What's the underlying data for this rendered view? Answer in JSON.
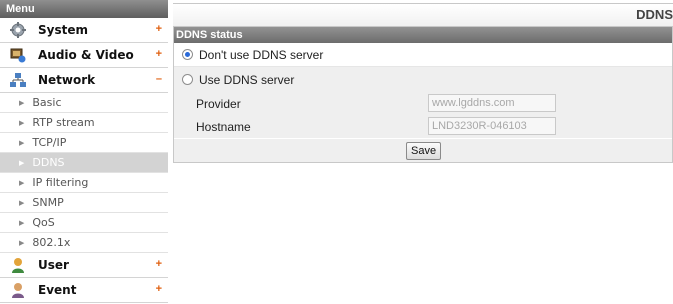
{
  "sidebar": {
    "header": "Menu",
    "sections": [
      {
        "label": "System",
        "toggle": "+",
        "icon": "gear-icon"
      },
      {
        "label": "Audio & Video",
        "toggle": "+",
        "icon": "camera-icon"
      },
      {
        "label": "Network",
        "toggle": "–",
        "icon": "network-icon"
      }
    ],
    "network_items": [
      "Basic",
      "RTP stream",
      "TCP/IP",
      "DDNS",
      "IP filtering",
      "SNMP",
      "QoS",
      "802.1x"
    ],
    "active_item": "DDNS",
    "lower_sections": [
      {
        "label": "User",
        "toggle": "+",
        "icon": "user-icon"
      },
      {
        "label": "Event",
        "toggle": "+",
        "icon": "event-icon"
      }
    ]
  },
  "main": {
    "page_title": "DDNS",
    "panel_title": "DDNS status",
    "options": {
      "dont_use": "Don't use DDNS server",
      "use": "Use DDNS server",
      "selected": "dont_use"
    },
    "provider": {
      "label": "Provider",
      "value": "www.lgddns.com"
    },
    "hostname": {
      "label": "Hostname",
      "value": "LND3230R-046103"
    },
    "save_label": "Save"
  },
  "colors": {
    "accent_toggle": "#e06010",
    "radio_selected": "#2a6ad9",
    "active_item_bg": "#d3d3d3"
  }
}
